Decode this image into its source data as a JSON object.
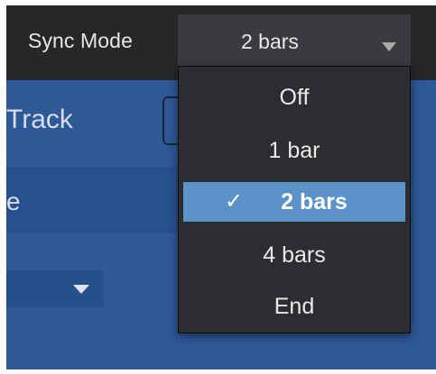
{
  "topbar": {
    "label": "Sync Mode",
    "select_value": "2 bars",
    "select_caret_icon": "caret-down-icon"
  },
  "background_panel": {
    "track_text": "Track",
    "band_text": "e",
    "lower_select_caret_icon": "caret-down-icon"
  },
  "dropdown": {
    "options": [
      {
        "label": "Off",
        "selected": false
      },
      {
        "label": "1 bar",
        "selected": false
      },
      {
        "label": "2 bars",
        "selected": true,
        "check_icon": "checkmark-icon",
        "check_glyph": "✓"
      },
      {
        "label": "4 bars",
        "selected": false
      },
      {
        "label": "End",
        "selected": false
      }
    ]
  },
  "colors": {
    "topbar_bg": "#262729",
    "panel_bg": "#2f5897",
    "menu_bg": "#2c2d30",
    "highlight": "#5b93c8"
  }
}
